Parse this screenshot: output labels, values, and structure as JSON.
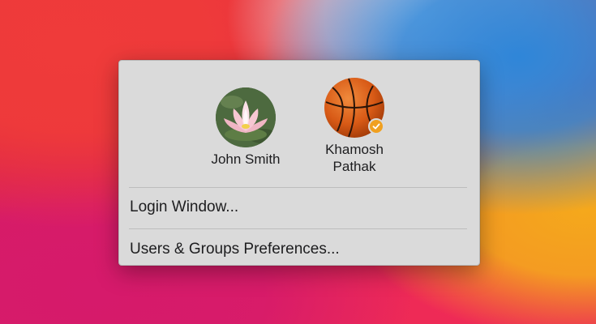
{
  "menu": {
    "users": [
      {
        "name": "John Smith",
        "avatar": "lotus-flower-photo",
        "current": false
      },
      {
        "name": "Khamosh Pathak",
        "name_line1": "Khamosh",
        "name_line2": "Pathak",
        "avatar": "basketball-photo",
        "current": true
      }
    ],
    "items": [
      {
        "label": "Login Window..."
      },
      {
        "label": "Users & Groups Preferences..."
      }
    ]
  },
  "colors": {
    "menu_background": "#dadada",
    "current_user_badge": "#f0a020",
    "text": "#1d1d1f"
  },
  "icons": {
    "current_user_badge": "checkmark-icon"
  }
}
